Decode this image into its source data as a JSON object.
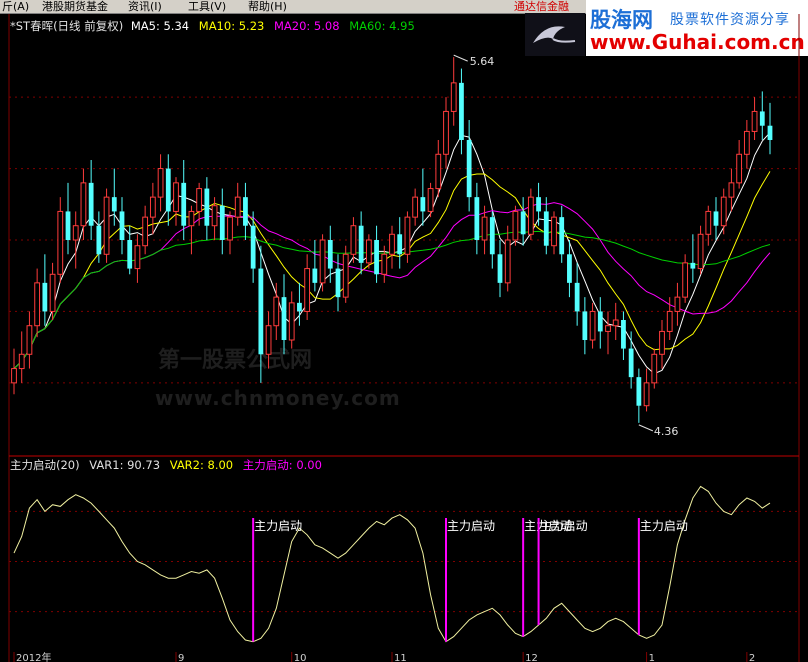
{
  "menu": {
    "items": [
      "斤(A)",
      "港股期货基金",
      "资讯(I)",
      "工具(V)",
      "帮助(H)"
    ],
    "promo": "通达信金融",
    "extra": "…"
  },
  "brand": {
    "name": "股海网",
    "slogan": "股票软件资源分享",
    "url": "www.Guhai.com.cn"
  },
  "watermark": {
    "line1": "第一股票公式网",
    "line2": "www.chnmoney.com"
  },
  "main_header": {
    "title": "*ST春晖(日线 前复权)",
    "ma5": "MA5: 5.34",
    "ma10": "MA10: 5.23",
    "ma20": "MA20: 5.08",
    "ma60": "MA60: 4.95"
  },
  "sub_header": {
    "title": "主力启动(20)",
    "var1": "VAR1: 90.73",
    "var2": "VAR2: 8.00",
    "signal": "主力启动: 0.00"
  },
  "colors": {
    "up": "#ff3c3c",
    "down": "#54ffff",
    "ma5": "#ffffff",
    "ma10": "#ffff00",
    "ma20": "#ff00ff",
    "ma60": "#00d000",
    "signal": "#ff00ff",
    "grid": "#800000",
    "axis_text": "#d0d0d0"
  },
  "chart_data": [
    {
      "type": "candlestick",
      "title": "*ST春晖(日线 前复权)",
      "annotations": {
        "high": "5.64",
        "low": "4.36"
      },
      "ohlc": [
        [
          4.5,
          4.62,
          4.46,
          4.55
        ],
        [
          4.55,
          4.68,
          4.5,
          4.6
        ],
        [
          4.6,
          4.75,
          4.55,
          4.7
        ],
        [
          4.7,
          4.9,
          4.66,
          4.85
        ],
        [
          4.85,
          4.95,
          4.7,
          4.75
        ],
        [
          4.75,
          4.92,
          4.72,
          4.88
        ],
        [
          4.88,
          5.15,
          4.85,
          5.1
        ],
        [
          5.1,
          5.2,
          4.95,
          5.0
        ],
        [
          5.0,
          5.1,
          4.9,
          5.05
        ],
        [
          5.05,
          5.25,
          5.0,
          5.2
        ],
        [
          5.2,
          5.28,
          5.0,
          5.05
        ],
        [
          5.05,
          5.1,
          4.92,
          4.95
        ],
        [
          4.95,
          5.18,
          4.92,
          5.15
        ],
        [
          5.15,
          5.25,
          5.05,
          5.1
        ],
        [
          5.1,
          5.15,
          4.95,
          5.0
        ],
        [
          5.0,
          5.05,
          4.88,
          4.9
        ],
        [
          4.9,
          5.02,
          4.85,
          4.98
        ],
        [
          4.98,
          5.12,
          4.95,
          5.08
        ],
        [
          5.08,
          5.2,
          5.02,
          5.15
        ],
        [
          5.15,
          5.3,
          5.1,
          5.25
        ],
        [
          5.25,
          5.3,
          5.05,
          5.1
        ],
        [
          5.1,
          5.22,
          5.05,
          5.2
        ],
        [
          5.2,
          5.28,
          5.0,
          5.05
        ],
        [
          5.05,
          5.12,
          4.95,
          5.1
        ],
        [
          5.1,
          5.2,
          5.05,
          5.18
        ],
        [
          5.18,
          5.22,
          5.0,
          5.05
        ],
        [
          5.05,
          5.15,
          5.0,
          5.12
        ],
        [
          5.12,
          5.18,
          4.95,
          5.0
        ],
        [
          5.0,
          5.1,
          4.95,
          5.08
        ],
        [
          5.08,
          5.2,
          5.05,
          5.15
        ],
        [
          5.15,
          5.2,
          5.0,
          5.05
        ],
        [
          5.05,
          5.1,
          4.85,
          4.9
        ],
        [
          4.9,
          4.98,
          4.5,
          4.6
        ],
        [
          4.6,
          4.75,
          4.55,
          4.7
        ],
        [
          4.7,
          4.85,
          4.65,
          4.8
        ],
        [
          4.8,
          4.88,
          4.6,
          4.65
        ],
        [
          4.65,
          4.82,
          4.62,
          4.78
        ],
        [
          4.78,
          4.85,
          4.7,
          4.75
        ],
        [
          4.75,
          4.95,
          4.72,
          4.9
        ],
        [
          4.9,
          5.0,
          4.82,
          4.85
        ],
        [
          4.85,
          5.02,
          4.82,
          5.0
        ],
        [
          5.0,
          5.05,
          4.85,
          4.9
        ],
        [
          4.9,
          4.95,
          4.75,
          4.8
        ],
        [
          4.8,
          4.98,
          4.78,
          4.95
        ],
        [
          4.95,
          5.08,
          4.92,
          5.05
        ],
        [
          5.05,
          5.1,
          4.88,
          4.92
        ],
        [
          4.92,
          5.02,
          4.9,
          5.0
        ],
        [
          5.0,
          5.05,
          4.85,
          4.88
        ],
        [
          4.88,
          4.98,
          4.85,
          4.95
        ],
        [
          4.95,
          5.05,
          4.9,
          5.02
        ],
        [
          5.02,
          5.08,
          4.9,
          4.95
        ],
        [
          4.95,
          5.1,
          4.92,
          5.08
        ],
        [
          5.08,
          5.18,
          5.05,
          5.15
        ],
        [
          5.15,
          5.25,
          5.05,
          5.1
        ],
        [
          5.1,
          5.2,
          5.08,
          5.18
        ],
        [
          5.18,
          5.35,
          5.15,
          5.3
        ],
        [
          5.3,
          5.5,
          5.25,
          5.45
        ],
        [
          5.45,
          5.64,
          5.4,
          5.55
        ],
        [
          5.55,
          5.6,
          5.3,
          5.35
        ],
        [
          5.35,
          5.42,
          5.1,
          5.15
        ],
        [
          5.15,
          5.2,
          4.95,
          5.0
        ],
        [
          5.0,
          5.12,
          4.95,
          5.08
        ],
        [
          5.08,
          5.1,
          4.9,
          4.95
        ],
        [
          4.95,
          5.0,
          4.8,
          4.85
        ],
        [
          4.85,
          5.05,
          4.82,
          5.0
        ],
        [
          5.0,
          5.12,
          4.98,
          5.1
        ],
        [
          5.1,
          5.15,
          4.98,
          5.02
        ],
        [
          5.02,
          5.18,
          5.0,
          5.15
        ],
        [
          5.15,
          5.2,
          5.05,
          5.1
        ],
        [
          5.1,
          5.15,
          4.95,
          4.98
        ],
        [
          4.98,
          5.1,
          4.95,
          5.08
        ],
        [
          5.08,
          5.12,
          4.92,
          4.95
        ],
        [
          4.95,
          5.0,
          4.8,
          4.85
        ],
        [
          4.85,
          4.92,
          4.7,
          4.75
        ],
        [
          4.75,
          4.8,
          4.6,
          4.65
        ],
        [
          4.65,
          4.78,
          4.62,
          4.75
        ],
        [
          4.75,
          4.8,
          4.62,
          4.68
        ],
        [
          4.68,
          4.75,
          4.6,
          4.7
        ],
        [
          4.7,
          4.78,
          4.65,
          4.72
        ],
        [
          4.72,
          4.75,
          4.58,
          4.62
        ],
        [
          4.62,
          4.68,
          4.48,
          4.52
        ],
        [
          4.52,
          4.55,
          4.36,
          4.42
        ],
        [
          4.42,
          4.55,
          4.4,
          4.5
        ],
        [
          4.5,
          4.62,
          4.48,
          4.6
        ],
        [
          4.6,
          4.72,
          4.55,
          4.68
        ],
        [
          4.68,
          4.8,
          4.65,
          4.75
        ],
        [
          4.75,
          4.85,
          4.7,
          4.8
        ],
        [
          4.8,
          4.95,
          4.78,
          4.92
        ],
        [
          4.92,
          5.02,
          4.85,
          4.9
        ],
        [
          4.9,
          5.05,
          4.88,
          5.02
        ],
        [
          5.02,
          5.12,
          4.98,
          5.1
        ],
        [
          5.1,
          5.15,
          5.0,
          5.05
        ],
        [
          5.05,
          5.18,
          5.02,
          5.15
        ],
        [
          5.15,
          5.25,
          5.1,
          5.2
        ],
        [
          5.2,
          5.35,
          5.18,
          5.3
        ],
        [
          5.3,
          5.42,
          5.25,
          5.38
        ],
        [
          5.38,
          5.5,
          5.35,
          5.45
        ],
        [
          5.45,
          5.52,
          5.35,
          5.4
        ],
        [
          5.4,
          5.48,
          5.3,
          5.35
        ]
      ],
      "ma": [
        {
          "name": "MA5",
          "value": 5.34
        },
        {
          "name": "MA10",
          "value": 5.23
        },
        {
          "name": "MA20",
          "value": 5.08
        },
        {
          "name": "MA60",
          "value": 4.95
        }
      ],
      "x_ticks": [
        "2012年",
        "9",
        "10",
        "11",
        "12",
        "1",
        "2"
      ]
    },
    {
      "type": "line",
      "title": "主力启动(20)",
      "series": [
        {
          "name": "VAR1",
          "values": [
            55,
            65,
            82,
            87,
            80,
            84,
            83,
            87,
            90,
            88,
            85,
            80,
            75,
            70,
            62,
            55,
            50,
            48,
            45,
            42,
            40,
            40,
            42,
            44,
            43,
            45,
            40,
            28,
            15,
            8,
            3,
            2,
            4,
            10,
            22,
            42,
            62,
            70,
            66,
            60,
            58,
            55,
            52,
            55,
            60,
            65,
            70,
            74,
            72,
            76,
            78,
            75,
            70,
            55,
            30,
            10,
            2,
            5,
            10,
            15,
            18,
            20,
            22,
            18,
            12,
            7,
            5,
            8,
            12,
            16,
            22,
            25,
            20,
            15,
            10,
            8,
            10,
            14,
            16,
            14,
            10,
            6,
            4,
            6,
            12,
            35,
            60,
            75,
            88,
            95,
            92,
            85,
            80,
            78,
            84,
            88,
            86,
            82,
            85
          ]
        },
        {
          "name": "VAR2",
          "values": [
            8
          ]
        }
      ],
      "signal_label": "主力启动",
      "signals": [
        {
          "index": 31,
          "label": "主力启动"
        },
        {
          "index": 56,
          "label": "主力启动"
        },
        {
          "index": 66,
          "label": "主力启动"
        },
        {
          "index": 68,
          "label": "主力启动"
        },
        {
          "index": 81,
          "label": "主力启动"
        }
      ],
      "last_values": {
        "VAR1": 90.73,
        "VAR2": 8.0,
        "主力启动": 0.0
      }
    }
  ]
}
